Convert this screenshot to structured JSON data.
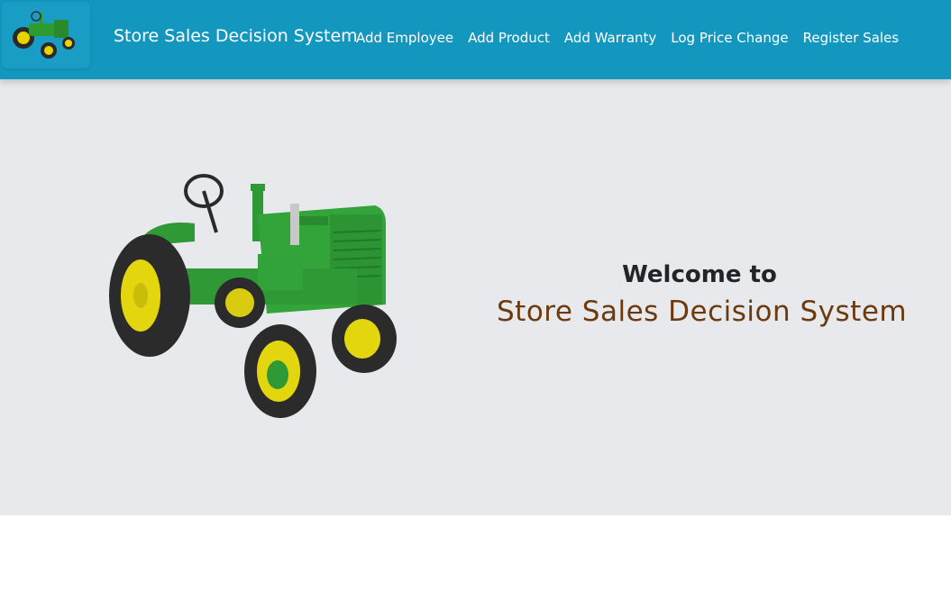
{
  "navbar": {
    "brand": "Store Sales Decision System",
    "logo_icon": "tractor-icon",
    "links": [
      {
        "label": "Add Employee"
      },
      {
        "label": "Add Product"
      },
      {
        "label": "Add Warranty"
      },
      {
        "label": "Log Price Change"
      },
      {
        "label": "Register Sales"
      }
    ],
    "background_color": "#1497bf"
  },
  "hero": {
    "image": "tractor-image",
    "welcome_text": "Welcome to",
    "system_name": "Store Sales Decision System",
    "background_color": "#e7e9ec",
    "system_name_color": "#6b3b0f"
  }
}
